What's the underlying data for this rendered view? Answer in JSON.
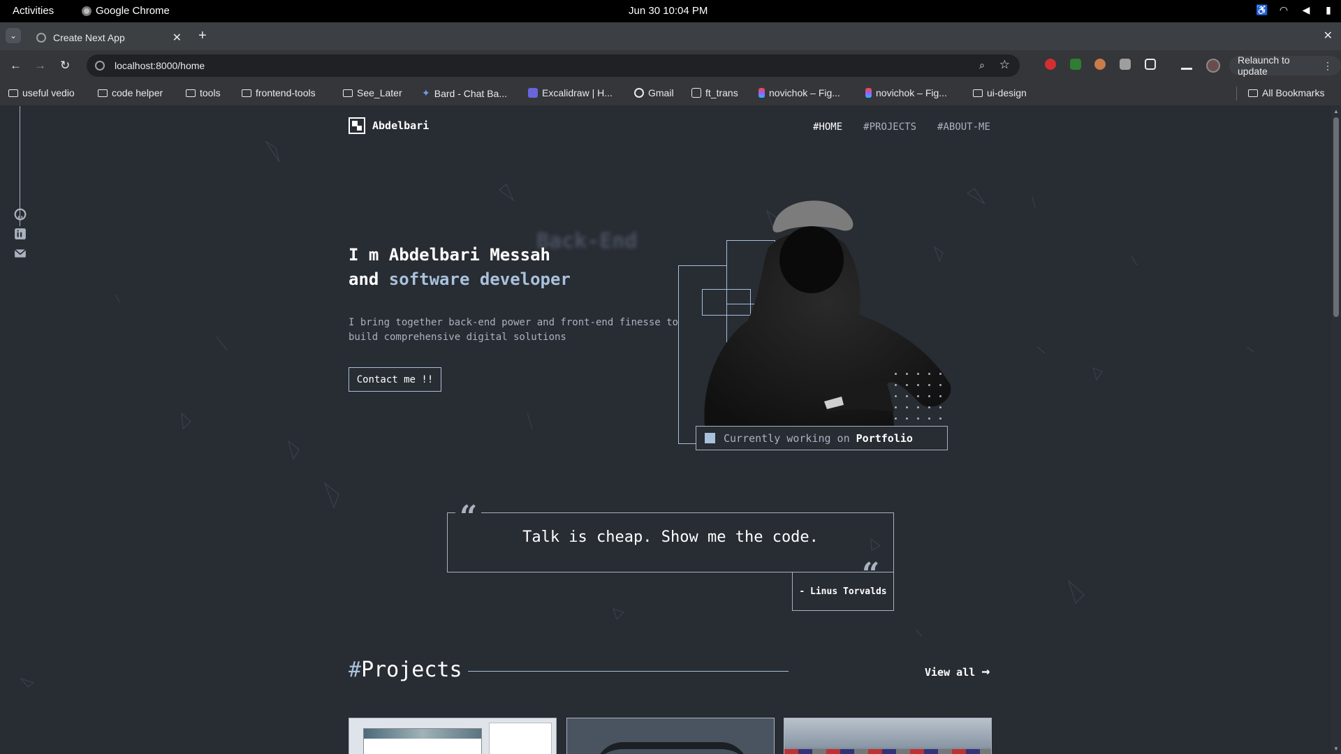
{
  "system": {
    "activities": "Activities",
    "app_name": "Google Chrome",
    "clock": "Jun 30  10:04 PM"
  },
  "browser": {
    "tab_title": "Create Next App",
    "url": "localhost:8000/home",
    "relaunch_label": "Relaunch to update",
    "bookmarks": [
      {
        "label": "useful vedio",
        "icon": "folder-icon"
      },
      {
        "label": "code helper",
        "icon": "folder-icon"
      },
      {
        "label": "tools",
        "icon": "folder-icon"
      },
      {
        "label": "frontend-tools",
        "icon": "folder-icon"
      },
      {
        "label": "See_Later",
        "icon": "folder-icon"
      },
      {
        "label": "Bard - Chat Ba...",
        "icon": "bard-icon"
      },
      {
        "label": "Excalidraw | H...",
        "icon": "excalidraw-icon"
      },
      {
        "label": "Gmail",
        "icon": "globe-icon"
      },
      {
        "label": "ft_trans",
        "icon": "notion-icon"
      },
      {
        "label": "novichok – Fig...",
        "icon": "figma-icon"
      },
      {
        "label": "novichok – Fig...",
        "icon": "figma-icon"
      },
      {
        "label": "ui-design",
        "icon": "folder-icon"
      }
    ],
    "all_bookmarks": "All Bookmarks"
  },
  "site": {
    "logo_text": "Abdelbari",
    "nav": [
      {
        "hash": "#",
        "label": "HOME",
        "active": true
      },
      {
        "hash": "#",
        "label": "PROJECTS",
        "active": false
      },
      {
        "hash": "#",
        "label": "ABOUT-ME",
        "active": false
      }
    ],
    "hero": {
      "bg_word": "Back-End",
      "line1": "I m Abdelbari Messah",
      "line2_prefix": "and ",
      "line2_accent": "software developer",
      "subtitle": "I bring together back-end power and front-end finesse to build comprehensive digital solutions",
      "cta": "Contact me !!"
    },
    "working": {
      "prefix": "Currently working on ",
      "project": "Portfolio"
    },
    "quote": {
      "text": "Talk is cheap. Show me the code.",
      "author": "- Linus Torvalds"
    },
    "projects_section": {
      "hash": "#",
      "title": "Projects",
      "view_all": "View all",
      "view_all_arrow": "→"
    }
  },
  "colors": {
    "background": "#282c33",
    "accent": "#a9c1dc",
    "muted_text": "#abb2bf"
  }
}
